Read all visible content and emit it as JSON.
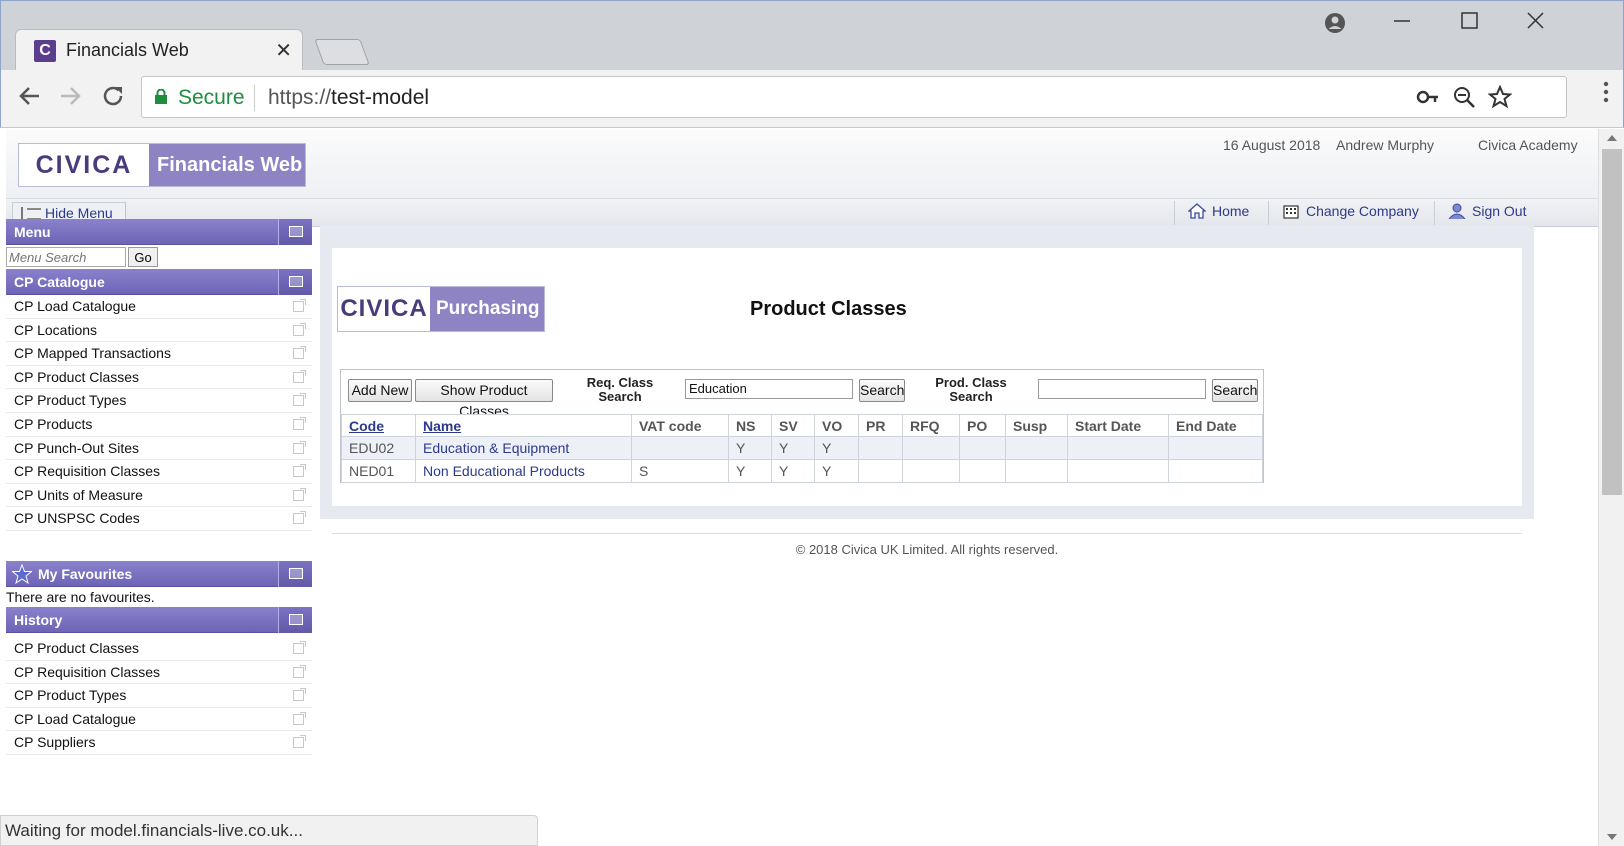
{
  "browser": {
    "tab_title": "Financials Web",
    "tab_favicon": "C",
    "tab_close": "✕",
    "secure_label": "Secure",
    "url_scheme": "https://",
    "url_host": "test-model",
    "status_text": "Waiting for model.financials-live.co.uk..."
  },
  "header": {
    "logo_left": "CIVICA",
    "logo_right": "Financials Web",
    "date": "16 August 2018",
    "user": "Andrew Murphy",
    "org": "Civica Academy"
  },
  "subbar": {
    "hide_menu": "Hide Menu",
    "home": "Home",
    "change_company": "Change Company",
    "sign_out": "Sign Out"
  },
  "sidebar": {
    "menu_title": "Menu",
    "menu_search_placeholder": "Menu Search",
    "go_label": "Go",
    "catalogue_title": "CP Catalogue",
    "catalogue_items": [
      "CP Load Catalogue",
      "CP Locations",
      "CP Mapped Transactions",
      "CP Product Classes",
      "CP Product Types",
      "CP Products",
      "CP Punch-Out Sites",
      "CP Requisition Classes",
      "CP Units of Measure",
      "CP UNSPSC Codes"
    ],
    "favourites_title": "My Favourites",
    "favourites_empty": "There are no favourites.",
    "history_title": "History",
    "history_items": [
      "CP Product Classes",
      "CP Requisition Classes",
      "CP Product Types",
      "CP Load Catalogue",
      "CP Suppliers"
    ]
  },
  "main": {
    "logo_left": "CIVICA",
    "logo_right": "Purchasing",
    "title": "Product Classes",
    "add_new": "Add New",
    "show_product_classes": "Show Product Classes",
    "req_class_label_1": "Req. Class",
    "req_class_label_2": "Search",
    "req_class_value": "Education",
    "search_label": "Search",
    "prod_class_label_1": "Prod. Class",
    "prod_class_label_2": "Search",
    "prod_class_value": "",
    "columns": [
      "Code",
      "Name",
      "VAT code",
      "NS",
      "SV",
      "VO",
      "PR",
      "RFQ",
      "PO",
      "Susp",
      "Start Date",
      "End Date"
    ],
    "rows": [
      [
        "EDU02",
        "Education & Equipment",
        "",
        "Y",
        "Y",
        "Y",
        "",
        "",
        "",
        "",
        "",
        ""
      ],
      [
        "NED01",
        "Non Educational Products",
        "S",
        "Y",
        "Y",
        "Y",
        "",
        "",
        "",
        "",
        "",
        ""
      ]
    ],
    "footer": "© 2018 Civica UK Limited. All rights reserved."
  },
  "colors": {
    "brand_purple": "#8e84c4",
    "panel_header": "#6d64b6",
    "link": "#2b3a8a",
    "secure_green": "#1e8e3e"
  }
}
